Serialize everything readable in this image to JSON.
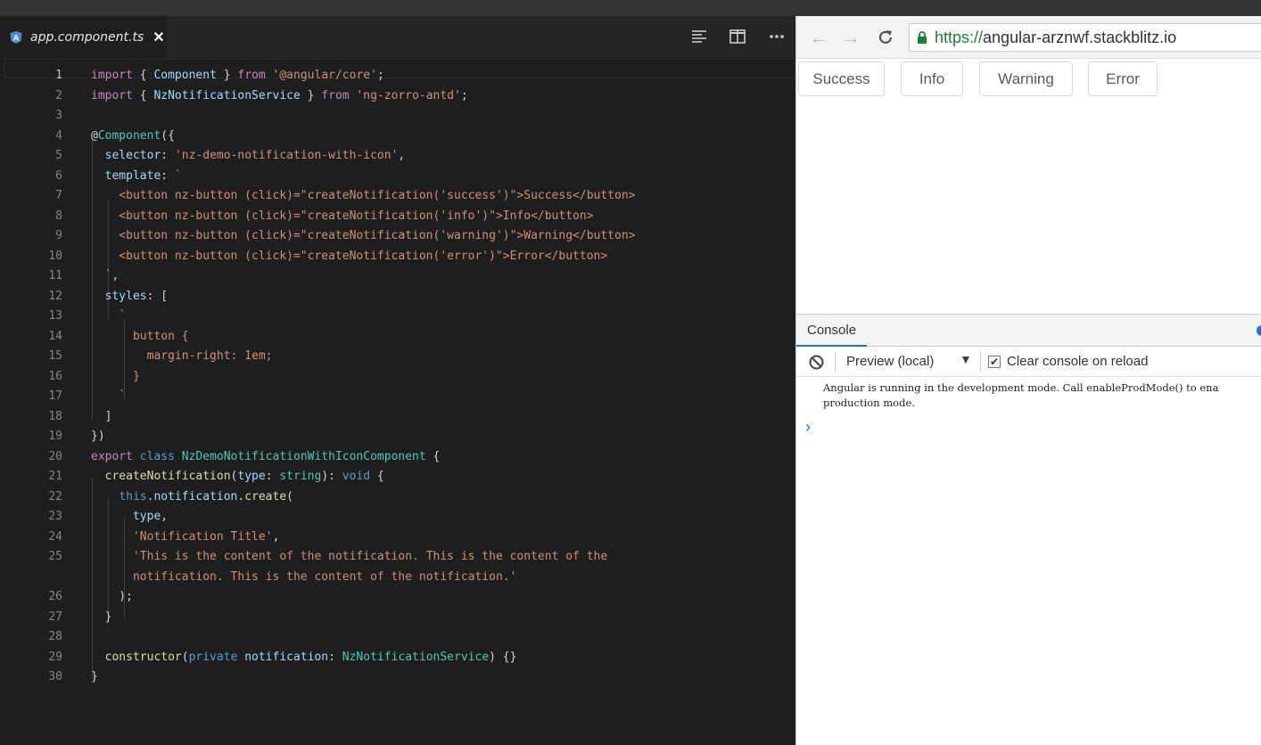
{
  "tab": {
    "filename": "app.component.ts",
    "close": "✕"
  },
  "editor_actions": [
    "align-left-icon",
    "split-editor-icon",
    "more-icon"
  ],
  "code_lines": [
    {
      "n": "1",
      "tokens": [
        [
          "kw",
          "import"
        ],
        [
          "pl",
          " { "
        ],
        [
          "id",
          "Component"
        ],
        [
          "pl",
          " } "
        ],
        [
          "kw",
          "from"
        ],
        [
          "pl",
          " "
        ],
        [
          "st",
          "'@angular/core'"
        ],
        [
          "pl",
          ";"
        ]
      ]
    },
    {
      "n": "2",
      "tokens": [
        [
          "kw",
          "import"
        ],
        [
          "pl",
          " { "
        ],
        [
          "id",
          "NzNotificationService"
        ],
        [
          "pl",
          " } "
        ],
        [
          "kw",
          "from"
        ],
        [
          "pl",
          " "
        ],
        [
          "st",
          "'ng-zorro-antd'"
        ],
        [
          "pl",
          ";"
        ]
      ]
    },
    {
      "n": "3",
      "tokens": []
    },
    {
      "n": "4",
      "tokens": [
        [
          "pl",
          "@"
        ],
        [
          "ty",
          "Component"
        ],
        [
          "pl",
          "({"
        ]
      ]
    },
    {
      "n": "5",
      "tokens": [
        [
          "pl",
          "  "
        ],
        [
          "id",
          "selector"
        ],
        [
          "pl",
          ": "
        ],
        [
          "st",
          "'nz-demo-notification-with-icon'"
        ],
        [
          "pl",
          ","
        ]
      ]
    },
    {
      "n": "6",
      "tokens": [
        [
          "pl",
          "  "
        ],
        [
          "id",
          "template"
        ],
        [
          "pl",
          ": "
        ],
        [
          "st",
          "`"
        ]
      ]
    },
    {
      "n": "7",
      "tokens": [
        [
          "st",
          "    <button nz-button (click)=\"createNotification('success')\">Success</button>"
        ]
      ]
    },
    {
      "n": "8",
      "tokens": [
        [
          "st",
          "    <button nz-button (click)=\"createNotification('info')\">Info</button>"
        ]
      ]
    },
    {
      "n": "9",
      "tokens": [
        [
          "st",
          "    <button nz-button (click)=\"createNotification('warning')\">Warning</button>"
        ]
      ]
    },
    {
      "n": "10",
      "tokens": [
        [
          "st",
          "    <button nz-button (click)=\"createNotification('error')\">Error</button>"
        ]
      ]
    },
    {
      "n": "11",
      "tokens": [
        [
          "st",
          "  `"
        ],
        [
          "pl",
          ","
        ]
      ]
    },
    {
      "n": "12",
      "tokens": [
        [
          "pl",
          "  "
        ],
        [
          "id",
          "styles"
        ],
        [
          "pl",
          ": ["
        ]
      ]
    },
    {
      "n": "13",
      "tokens": [
        [
          "st",
          "    `"
        ]
      ]
    },
    {
      "n": "14",
      "tokens": [
        [
          "st",
          "      button {"
        ]
      ]
    },
    {
      "n": "15",
      "tokens": [
        [
          "st",
          "        margin-right: 1em;"
        ]
      ]
    },
    {
      "n": "16",
      "tokens": [
        [
          "st",
          "      }"
        ]
      ]
    },
    {
      "n": "17",
      "tokens": [
        [
          "st",
          "    `"
        ]
      ]
    },
    {
      "n": "18",
      "tokens": [
        [
          "pl",
          "  ]"
        ]
      ]
    },
    {
      "n": "19",
      "tokens": [
        [
          "pl",
          "})"
        ]
      ]
    },
    {
      "n": "20",
      "tokens": [
        [
          "kw",
          "export"
        ],
        [
          "pl",
          " "
        ],
        [
          "bl",
          "class"
        ],
        [
          "pl",
          " "
        ],
        [
          "ty",
          "NzDemoNotificationWithIconComponent"
        ],
        [
          "pl",
          " {"
        ]
      ]
    },
    {
      "n": "21",
      "tokens": [
        [
          "pl",
          "  "
        ],
        [
          "fn",
          "createNotification"
        ],
        [
          "pl",
          "("
        ],
        [
          "id",
          "type"
        ],
        [
          "pl",
          ": "
        ],
        [
          "ty",
          "string"
        ],
        [
          "pl",
          "): "
        ],
        [
          "bl",
          "void"
        ],
        [
          "pl",
          " {"
        ]
      ]
    },
    {
      "n": "22",
      "tokens": [
        [
          "pl",
          "    "
        ],
        [
          "bl",
          "this"
        ],
        [
          "pl",
          "."
        ],
        [
          "id",
          "notification"
        ],
        [
          "pl",
          "."
        ],
        [
          "fn",
          "create"
        ],
        [
          "pl",
          "("
        ]
      ]
    },
    {
      "n": "23",
      "tokens": [
        [
          "pl",
          "      "
        ],
        [
          "id",
          "type"
        ],
        [
          "pl",
          ","
        ]
      ]
    },
    {
      "n": "24",
      "tokens": [
        [
          "pl",
          "      "
        ],
        [
          "st",
          "'Notification Title'"
        ],
        [
          "pl",
          ","
        ]
      ]
    },
    {
      "n": "25",
      "tokens": [
        [
          "pl",
          "      "
        ],
        [
          "st",
          "'This is the content of the notification. This is the content of the"
        ]
      ]
    },
    {
      "n": "",
      "tokens": [
        [
          "pl",
          "      "
        ],
        [
          "st",
          "notification. This is the content of the notification.'"
        ]
      ]
    },
    {
      "n": "26",
      "tokens": [
        [
          "pl",
          "    );"
        ]
      ]
    },
    {
      "n": "27",
      "tokens": [
        [
          "pl",
          "  }"
        ]
      ]
    },
    {
      "n": "28",
      "tokens": []
    },
    {
      "n": "29",
      "tokens": [
        [
          "pl",
          "  "
        ],
        [
          "fn",
          "constructor"
        ],
        [
          "pl",
          "("
        ],
        [
          "bl",
          "private"
        ],
        [
          "pl",
          " "
        ],
        [
          "id",
          "notification"
        ],
        [
          "pl",
          ": "
        ],
        [
          "ty",
          "NzNotificationService"
        ],
        [
          "pl",
          ") {}"
        ]
      ]
    },
    {
      "n": "30",
      "tokens": [
        [
          "pl",
          "}"
        ]
      ]
    }
  ],
  "browser": {
    "url_scheme": "https://",
    "url_host": "angular-arznwf.stackblitz.io"
  },
  "demo_buttons": [
    "Success",
    "Info",
    "Warning",
    "Error"
  ],
  "console": {
    "tab_label": "Console",
    "context": "Preview (local)",
    "clear_label": "Clear console on reload",
    "clear_checked": true,
    "message_line1": "Angular is running in the development mode. Call enableProdMode() to ena",
    "message_line2": "production mode.",
    "prompt": "›"
  },
  "colors": {
    "accent": "#1a73e8",
    "lock": "#188038"
  }
}
